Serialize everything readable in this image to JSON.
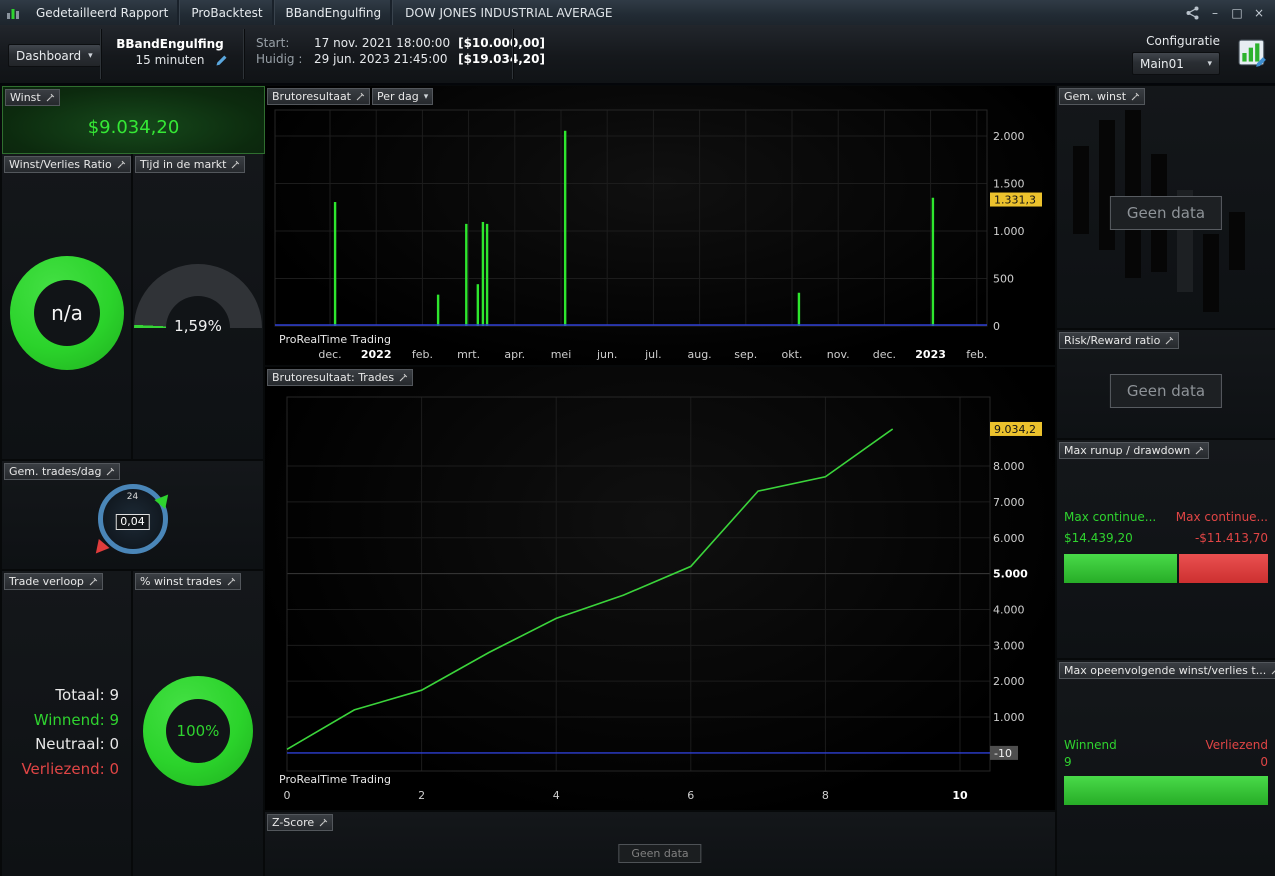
{
  "icons": {
    "minimize": "–",
    "maximize": "□",
    "close": "×",
    "chevron_down": "▾"
  },
  "titlebar": {
    "app_tabs": [
      "Gedetailleerd Rapport",
      "ProBacktest",
      "BBandEngulfing"
    ],
    "instrument": "DOW JONES INDUSTRIAL AVERAGE"
  },
  "toolbar": {
    "dashboard": "Dashboard",
    "strategy_name": "BBandEngulfing",
    "strategy_timeframe": "15 minuten",
    "start_label": "Start:",
    "start_datetime": "17 nov. 2021 18:00:00",
    "start_capital": "[$10.000,00]",
    "current_label": "Huidig :",
    "current_datetime": "29 jun. 2023 21:45:00",
    "current_capital": "[$19.034,20]",
    "config_label": "Configuratie",
    "config_selected": "Main01"
  },
  "panels": {
    "winst": {
      "title": "Winst",
      "value": "$9.034,20"
    },
    "winst_verlies_ratio": {
      "title": "Winst/Verlies Ratio",
      "value": "n/a"
    },
    "tijd_in_de_markt": {
      "title": "Tijd in de markt",
      "value": "1,59%",
      "pct": 1.59
    },
    "gem_trades_dag": {
      "title": "Gem. trades/dag",
      "value": "0,04",
      "dial_label": "24"
    },
    "trade_verloop": {
      "title": "Trade verloop",
      "rows": [
        {
          "text": "Totaal: 9",
          "color": "#e8e8e8"
        },
        {
          "text": "Winnend: 9",
          "color": "#2fd32f"
        },
        {
          "text": "Neutraal: 0",
          "color": "#e8e8e8"
        },
        {
          "text": "Verliezend: 0",
          "color": "#e04545"
        }
      ]
    },
    "pct_winst_trades": {
      "title": "% winst trades",
      "value": "100%"
    },
    "gem_winst": {
      "title": "Gem. winst",
      "no_data": "Geen data"
    },
    "risk_reward": {
      "title": "Risk/Reward ratio",
      "no_data": "Geen data"
    },
    "max_runup_drawdown": {
      "title": "Max runup / drawdown",
      "runup_label": "Max continue...",
      "runup_value": "$14.439,20",
      "drawdown_label": "Max continue...",
      "drawdown_value": "-$11.413,70",
      "runup_bar_pct": 56,
      "drawdown_bar_pct": 44
    },
    "max_opeenvolgende": {
      "title": "Max opeenvolgende winst/verlies t...",
      "win_label": "Winnend",
      "win_value": "9",
      "loss_label": "Verliezend",
      "loss_value": "0"
    },
    "z_score": {
      "title": "Z-Score",
      "no_data": "Geen data"
    }
  },
  "chart_data": [
    {
      "type": "bar",
      "title": "Brutoresultaat",
      "period_selector": "Per dag",
      "watermark": "ProRealTime Trading",
      "x_tick_labels": [
        "dec.",
        "2022",
        "feb.",
        "mrt.",
        "apr.",
        "mei",
        "jun.",
        "jul.",
        "aug.",
        "sep.",
        "okt.",
        "nov.",
        "dec.",
        "2023",
        "feb."
      ],
      "y_ticks": [
        0,
        500,
        1000,
        1500,
        2000
      ],
      "y_tick_labels": [
        "0",
        "500",
        "1.000",
        "1.500",
        "2.000"
      ],
      "ylim": [
        0,
        2270
      ],
      "current_value": 1331.3,
      "current_value_label": "1.331,3",
      "bars": [
        {
          "m": 0.11,
          "v": 1305
        },
        {
          "m": 2.34,
          "v": 330
        },
        {
          "m": 2.95,
          "v": 1075
        },
        {
          "m": 3.2,
          "v": 440
        },
        {
          "m": 3.31,
          "v": 1095
        },
        {
          "m": 3.4,
          "v": 1075
        },
        {
          "m": 5.09,
          "v": 2055
        },
        {
          "m": 10.15,
          "v": 350
        },
        {
          "m": 13.05,
          "v": 1350
        }
      ]
    },
    {
      "type": "line",
      "title": "Brutoresultaat: Trades",
      "watermark": "ProRealTime Trading",
      "x": [
        0,
        1,
        2,
        3,
        4,
        5,
        6,
        7,
        8,
        9
      ],
      "values": [
        100,
        1200,
        1750,
        2800,
        3750,
        4400,
        5200,
        7300,
        7700,
        9034.2
      ],
      "x_ticks": [
        0,
        2,
        4,
        6,
        8,
        10
      ],
      "xlim": [
        0,
        10
      ],
      "y_ticks": [
        1000,
        2000,
        3000,
        4000,
        5000,
        6000,
        7000,
        8000
      ],
      "y_tick_labels": [
        "1.000",
        "2.000",
        "3.000",
        "4.000",
        "5.000",
        "6.000",
        "7.000",
        "8.000"
      ],
      "emphasized_y_tick": "5.000",
      "current_value_label": "9.034,2",
      "baseline_label": "-10",
      "ylim": [
        -100,
        9400
      ]
    }
  ],
  "colors": {
    "accent_green": "#2ee62e",
    "loss_red": "#e33b3b",
    "highlight_yellow": "#ecc22d",
    "zero_line_blue": "#2e3fd4",
    "grid": "#1c1c1c"
  }
}
